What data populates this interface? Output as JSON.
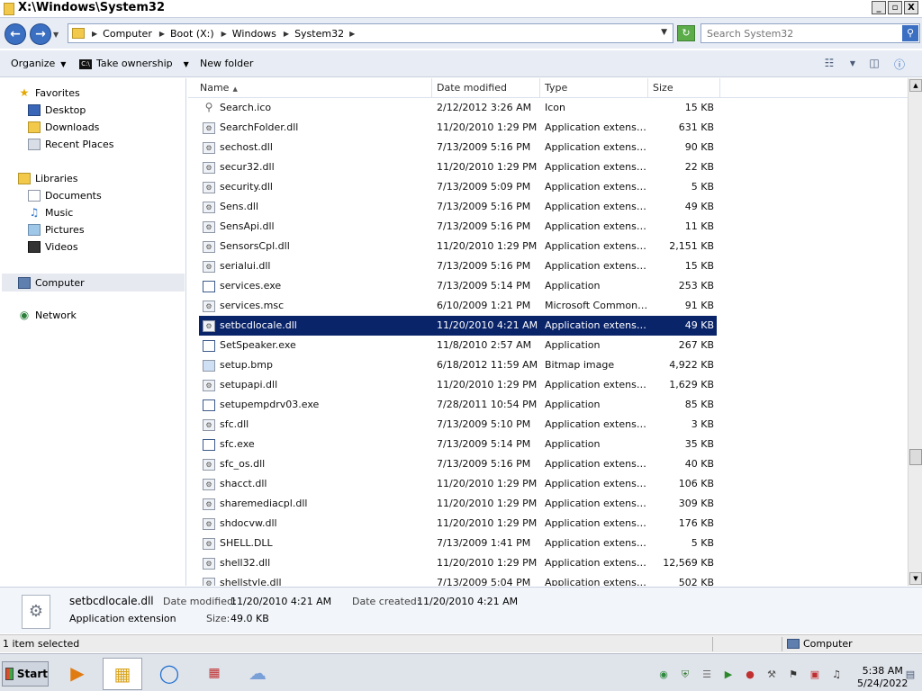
{
  "window": {
    "title": "X:\\Windows\\System32",
    "minimize": "_",
    "maximize": "▫",
    "close": "X"
  },
  "address": {
    "crumbs": [
      "Computer",
      "Boot (X:)",
      "Windows",
      "System32"
    ],
    "search_placeholder": "Search System32"
  },
  "toolbar": {
    "organize": "Organize",
    "take_ownership": "Take ownership",
    "new_folder": "New folder"
  },
  "nav": {
    "favorites": "Favorites",
    "desktop": "Desktop",
    "downloads": "Downloads",
    "recent": "Recent Places",
    "libraries": "Libraries",
    "documents": "Documents",
    "music": "Music",
    "pictures": "Pictures",
    "videos": "Videos",
    "computer": "Computer",
    "network": "Network"
  },
  "columns": {
    "name": "Name",
    "date": "Date modified",
    "type": "Type",
    "size": "Size"
  },
  "files": [
    {
      "name": "Search.ico",
      "date": "2/12/2012 3:26 AM",
      "type": "Icon",
      "size": "15 KB",
      "icon": "search"
    },
    {
      "name": "SearchFolder.dll",
      "date": "11/20/2010 1:29 PM",
      "type": "Application extension",
      "size": "631 KB",
      "icon": "dll"
    },
    {
      "name": "sechost.dll",
      "date": "7/13/2009 5:16 PM",
      "type": "Application extension",
      "size": "90 KB",
      "icon": "dll"
    },
    {
      "name": "secur32.dll",
      "date": "11/20/2010 1:29 PM",
      "type": "Application extension",
      "size": "22 KB",
      "icon": "dll"
    },
    {
      "name": "security.dll",
      "date": "7/13/2009 5:09 PM",
      "type": "Application extension",
      "size": "5 KB",
      "icon": "dll"
    },
    {
      "name": "Sens.dll",
      "date": "7/13/2009 5:16 PM",
      "type": "Application extension",
      "size": "49 KB",
      "icon": "dll"
    },
    {
      "name": "SensApi.dll",
      "date": "7/13/2009 5:16 PM",
      "type": "Application extension",
      "size": "11 KB",
      "icon": "dll"
    },
    {
      "name": "SensorsCpl.dll",
      "date": "11/20/2010 1:29 PM",
      "type": "Application extension",
      "size": "2,151 KB",
      "icon": "dll"
    },
    {
      "name": "serialui.dll",
      "date": "7/13/2009 5:16 PM",
      "type": "Application extension",
      "size": "15 KB",
      "icon": "dll"
    },
    {
      "name": "services.exe",
      "date": "7/13/2009 5:14 PM",
      "type": "Application",
      "size": "253 KB",
      "icon": "exe"
    },
    {
      "name": "services.msc",
      "date": "6/10/2009 1:21 PM",
      "type": "Microsoft Common ...",
      "size": "91 KB",
      "icon": "msc"
    },
    {
      "name": "setbcdlocale.dll",
      "date": "11/20/2010 4:21 AM",
      "type": "Application extension",
      "size": "49 KB",
      "icon": "dll",
      "selected": true
    },
    {
      "name": "SetSpeaker.exe",
      "date": "11/8/2010 2:57 AM",
      "type": "Application",
      "size": "267 KB",
      "icon": "exe"
    },
    {
      "name": "setup.bmp",
      "date": "6/18/2012 11:59 AM",
      "type": "Bitmap image",
      "size": "4,922 KB",
      "icon": "img"
    },
    {
      "name": "setupapi.dll",
      "date": "11/20/2010 1:29 PM",
      "type": "Application extension",
      "size": "1,629 KB",
      "icon": "dll"
    },
    {
      "name": "setupempdrv03.exe",
      "date": "7/28/2011 10:54 PM",
      "type": "Application",
      "size": "85 KB",
      "icon": "exe"
    },
    {
      "name": "sfc.dll",
      "date": "7/13/2009 5:10 PM",
      "type": "Application extension",
      "size": "3 KB",
      "icon": "dll"
    },
    {
      "name": "sfc.exe",
      "date": "7/13/2009 5:14 PM",
      "type": "Application",
      "size": "35 KB",
      "icon": "exe"
    },
    {
      "name": "sfc_os.dll",
      "date": "7/13/2009 5:16 PM",
      "type": "Application extension",
      "size": "40 KB",
      "icon": "dll"
    },
    {
      "name": "shacct.dll",
      "date": "11/20/2010 1:29 PM",
      "type": "Application extension",
      "size": "106 KB",
      "icon": "dll"
    },
    {
      "name": "sharemediacpl.dll",
      "date": "11/20/2010 1:29 PM",
      "type": "Application extension",
      "size": "309 KB",
      "icon": "dll"
    },
    {
      "name": "shdocvw.dll",
      "date": "11/20/2010 1:29 PM",
      "type": "Application extension",
      "size": "176 KB",
      "icon": "dll"
    },
    {
      "name": "SHELL.DLL",
      "date": "7/13/2009 1:41 PM",
      "type": "Application extension",
      "size": "5 KB",
      "icon": "dll"
    },
    {
      "name": "shell32.dll",
      "date": "11/20/2010 1:29 PM",
      "type": "Application extension",
      "size": "12,569 KB",
      "icon": "dll"
    },
    {
      "name": "shellstyle.dll",
      "date": "7/13/2009 5:04 PM",
      "type": "Application extension",
      "size": "502 KB",
      "icon": "dll"
    }
  ],
  "details": {
    "name": "setbcdlocale.dll",
    "type": "Application extension",
    "modified_label": "Date modified:",
    "modified": "11/20/2010 4:21 AM",
    "created_label": "Date created:",
    "created": "11/20/2010 4:21 AM",
    "size_label": "Size:",
    "size": "49.0 KB"
  },
  "status": {
    "selected": "1 item selected",
    "location": "Computer"
  },
  "taskbar": {
    "start": "Start",
    "time": "5:38 AM",
    "date": "5/24/2022"
  }
}
